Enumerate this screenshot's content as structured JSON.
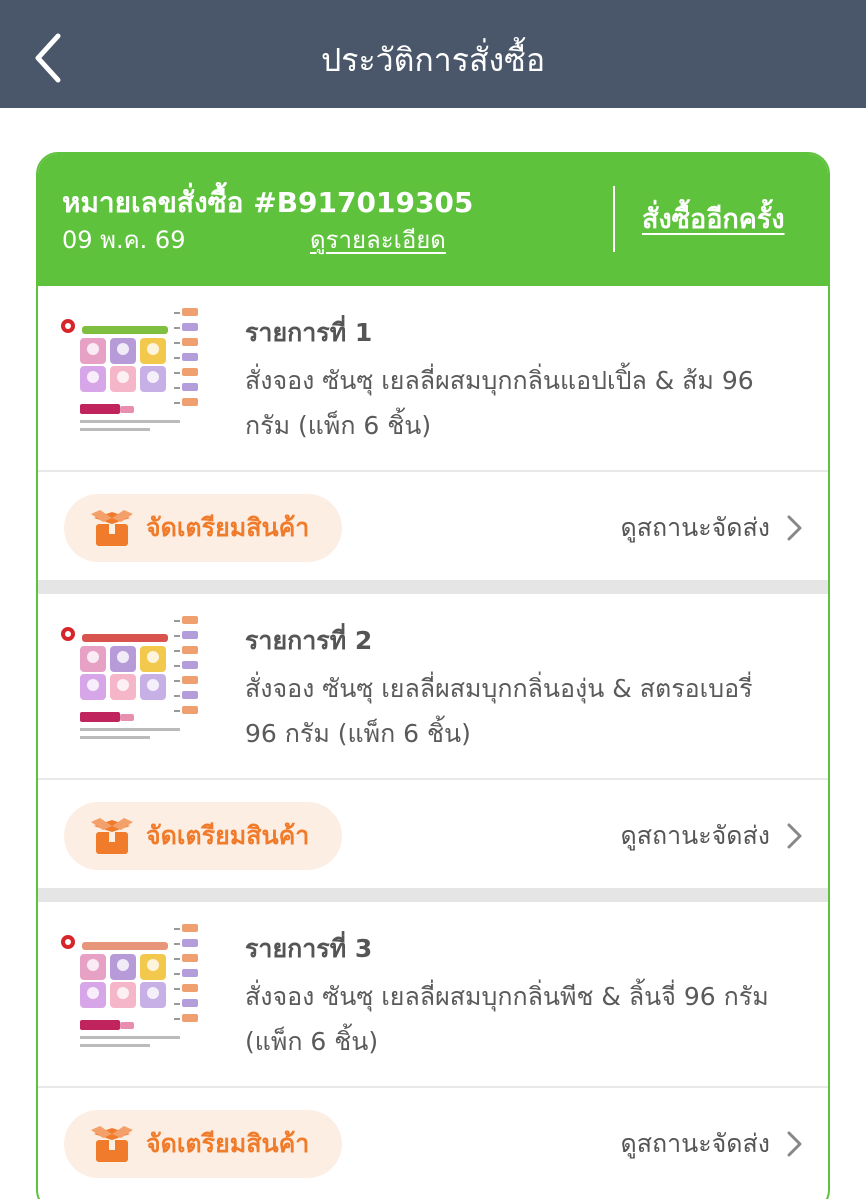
{
  "header": {
    "title": "ประวัติการสั่งซื้อ"
  },
  "order": {
    "number": "หมายเลขสั่งซื้อ #B917019305",
    "date": "09 พ.ค. 69",
    "detail_link": "ดูรายละเอียด",
    "reorder": "สั่งซื้ออีกครั้ง"
  },
  "items": [
    {
      "title": "รายการที่ 1",
      "description": "สั่งจอง  ซันซุ เยลลี่ผสมบุกกลิ่นแอปเปิ้ล & ส้ม 96 กรัม (แพ็ก 6 ชิ้น)",
      "status": "จัดเตรียมสินค้า",
      "track": "ดูสถานะจัดส่ง",
      "accent": "#7fbf3f"
    },
    {
      "title": "รายการที่ 2",
      "description": "สั่งจอง  ซันซุ เยลลี่ผสมบุกกลิ่นองุ่น & สตรอเบอรี่ 96 กรัม (แพ็ก 6 ชิ้น)",
      "status": "จัดเตรียมสินค้า",
      "track": "ดูสถานะจัดส่ง",
      "accent": "#d9534f"
    },
    {
      "title": "รายการที่ 3",
      "description": "สั่งจอง  ซันซุ เยลลี่ผสมบุกกลิ่นพีช & ลิ้นจี่ 96 กรัม (แพ็ก 6 ชิ้น)",
      "status": "จัดเตรียมสินค้า",
      "track": "ดูสถานะจัดส่ง",
      "accent": "#e8967a"
    }
  ],
  "colors": {
    "header_bg": "#4a5669",
    "order_green": "#5ec23c",
    "status_orange": "#f07b2a",
    "status_pill_bg": "#fdeee4"
  }
}
